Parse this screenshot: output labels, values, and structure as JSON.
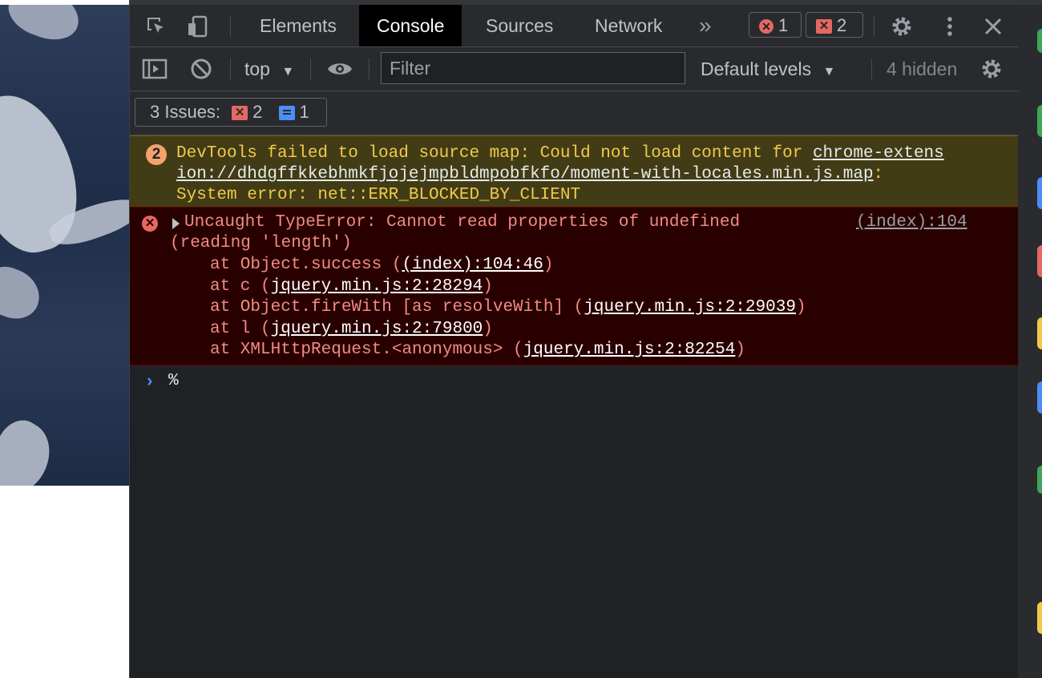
{
  "tabs": {
    "elements": "Elements",
    "console": "Console",
    "sources": "Sources",
    "network": "Network",
    "more": "»"
  },
  "counts": {
    "errors": "1",
    "issues": "2"
  },
  "toolbar": {
    "context": "top",
    "filter_placeholder": "Filter",
    "levels": "Default levels",
    "hidden": "4 hidden"
  },
  "issues_bar": {
    "label": "3 Issues:",
    "error_count": "2",
    "info_count": "1"
  },
  "warning": {
    "count": "2",
    "line1_text": "DevTools failed to load source map: Could not load content for ",
    "line1_link": "chrome-extens",
    "line2_link": "ion://dhdgffkkebhmkfjojejmpbldmpobfkfo/moment-with-locales.min.js.map",
    "line2_tail": ":",
    "line3": "System error: net::ERR_BLOCKED_BY_CLIENT"
  },
  "error": {
    "title": "Uncaught TypeError: Cannot read properties of undefined",
    "title_cont": "(reading 'length')",
    "source": "(index):104",
    "stack": [
      {
        "prefix": "at Object.success (",
        "link": "(index):104:46",
        "suffix": ")"
      },
      {
        "prefix": "at c (",
        "link": "jquery.min.js:2:28294",
        "suffix": ")"
      },
      {
        "prefix": "at Object.fireWith [as resolveWith] (",
        "link": "jquery.min.js:2:29039",
        "suffix": ")"
      },
      {
        "prefix": "at l (",
        "link": "jquery.min.js:2:79800",
        "suffix": ")"
      },
      {
        "prefix": "at XMLHttpRequest.<anonymous> (",
        "link": "jquery.min.js:2:82254",
        "suffix": ")"
      }
    ]
  },
  "console_input": {
    "prompt": "›",
    "value": "%"
  },
  "icons": [
    "inspect-icon",
    "device-toolbar-icon",
    "error-badge-icon",
    "issue-badge-icon",
    "settings-icon",
    "kebab-menu-icon",
    "close-icon",
    "sidebar-toggle-icon",
    "clear-console-icon",
    "dropdown-icon",
    "eye-icon",
    "gear-icon"
  ],
  "colors": {
    "warning_bg": "#413c15",
    "warning_text": "#f2c94c",
    "error_bg": "#290000",
    "error_text": "#f28b82",
    "accent_blue": "#4c8df6",
    "error_red": "#e46962"
  }
}
